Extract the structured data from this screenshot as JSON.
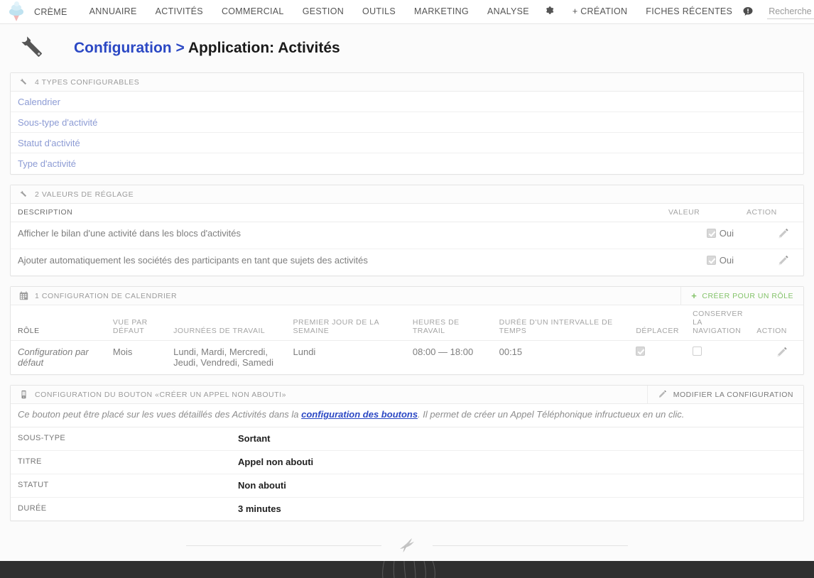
{
  "navbar": {
    "logo_icon": "ice-cream-logo",
    "brand": "CRÈME",
    "items": [
      {
        "label": "ANNUAIRE"
      },
      {
        "label": "ACTIVITÉS"
      },
      {
        "label": "COMMERCIAL"
      },
      {
        "label": "GESTION"
      },
      {
        "label": "OUTILS"
      },
      {
        "label": "MARKETING"
      },
      {
        "label": "ANALYSE"
      }
    ],
    "gear_icon": "gear-icon",
    "creation_label": "+ CRÉATION",
    "recent_label": "FICHES RÉCENTES",
    "alert_icon": "notification-bubble-icon",
    "search_placeholder": "Recherche",
    "search_value": "",
    "search_icon": "search-icon"
  },
  "page": {
    "header_icon": "wrench-icon",
    "breadcrumb_link": "Configuration",
    "breadcrumb_sep": ">",
    "title": "Application: Activités"
  },
  "types_panel": {
    "icon": "wrench-icon",
    "title": "4 TYPES CONFIGURABLES",
    "links": [
      "Calendrier",
      "Sous-type d'activité",
      "Statut d'activité",
      "Type d'activité"
    ]
  },
  "settings_panel": {
    "icon": "wrench-icon",
    "title": "2 VALEURS DE RÉGLAGE",
    "columns": [
      "DESCRIPTION",
      "VALEUR",
      "ACTION"
    ],
    "rows": [
      {
        "description": "Afficher le bilan d'une activité dans les blocs d'activités",
        "value_label": "Oui",
        "checked": true,
        "action_icon": "pencil-icon"
      },
      {
        "description": "Ajouter automatiquement les sociétés des participants en tant que sujets des activités",
        "value_label": "Oui",
        "checked": true,
        "action_icon": "pencil-icon"
      }
    ]
  },
  "calendar_panel": {
    "icon": "calendar-icon",
    "title": "1 CONFIGURATION DE CALENDRIER",
    "action_label": "CRÉER POUR UN RÔLE",
    "action_icon": "plus-icon",
    "columns": [
      "RÔLE",
      "VUE PAR DÉFAUT",
      "JOURNÉES DE TRAVAIL",
      "PREMIER JOUR DE LA SEMAINE",
      "HEURES DE TRAVAIL",
      "DURÉE D'UN INTERVALLE DE TEMPS",
      "DÉPLACER",
      "CONSERVER LA NAVIGATION",
      "ACTION"
    ],
    "rows": [
      {
        "role": "Configuration par défaut",
        "default_view": "Mois",
        "working_days": "Lundi, Mardi, Mercredi, Jeudi, Vendredi, Samedi",
        "first_day": "Lundi",
        "working_hours": "08:00 — 18:00",
        "slot_duration": "00:15",
        "drag_drop": true,
        "keep_navigation": false,
        "action_icon": "pencil-icon"
      }
    ]
  },
  "button_panel": {
    "icon": "mobile-phone-icon",
    "title": "CONFIGURATION DU BOUTON «CRÉER UN APPEL NON ABOUTI»",
    "action_label": "MODIFIER LA CONFIGURATION",
    "action_icon": "pencil-icon",
    "description_before": "Ce bouton peut être placé sur les vues détaillés des Activités dans la ",
    "description_link": "configuration des boutons",
    "description_after": ". Il permet de créer un Appel Téléphonique infructueux en un clic.",
    "rows": [
      {
        "key": "SOUS-TYPE",
        "value": "Sortant"
      },
      {
        "key": "TITRE",
        "value": "Appel non abouti"
      },
      {
        "key": "STATUT",
        "value": "Non abouti"
      },
      {
        "key": "DURÉE",
        "value": "3 minutes"
      }
    ]
  },
  "footer": {
    "bird_icon": "swallow-bird-icon"
  },
  "colors": {
    "accent_blue": "#2b48c4",
    "link_violet": "#8c9bd4",
    "action_green": "#84c36a",
    "footer_dark": "#2f2f2f"
  }
}
